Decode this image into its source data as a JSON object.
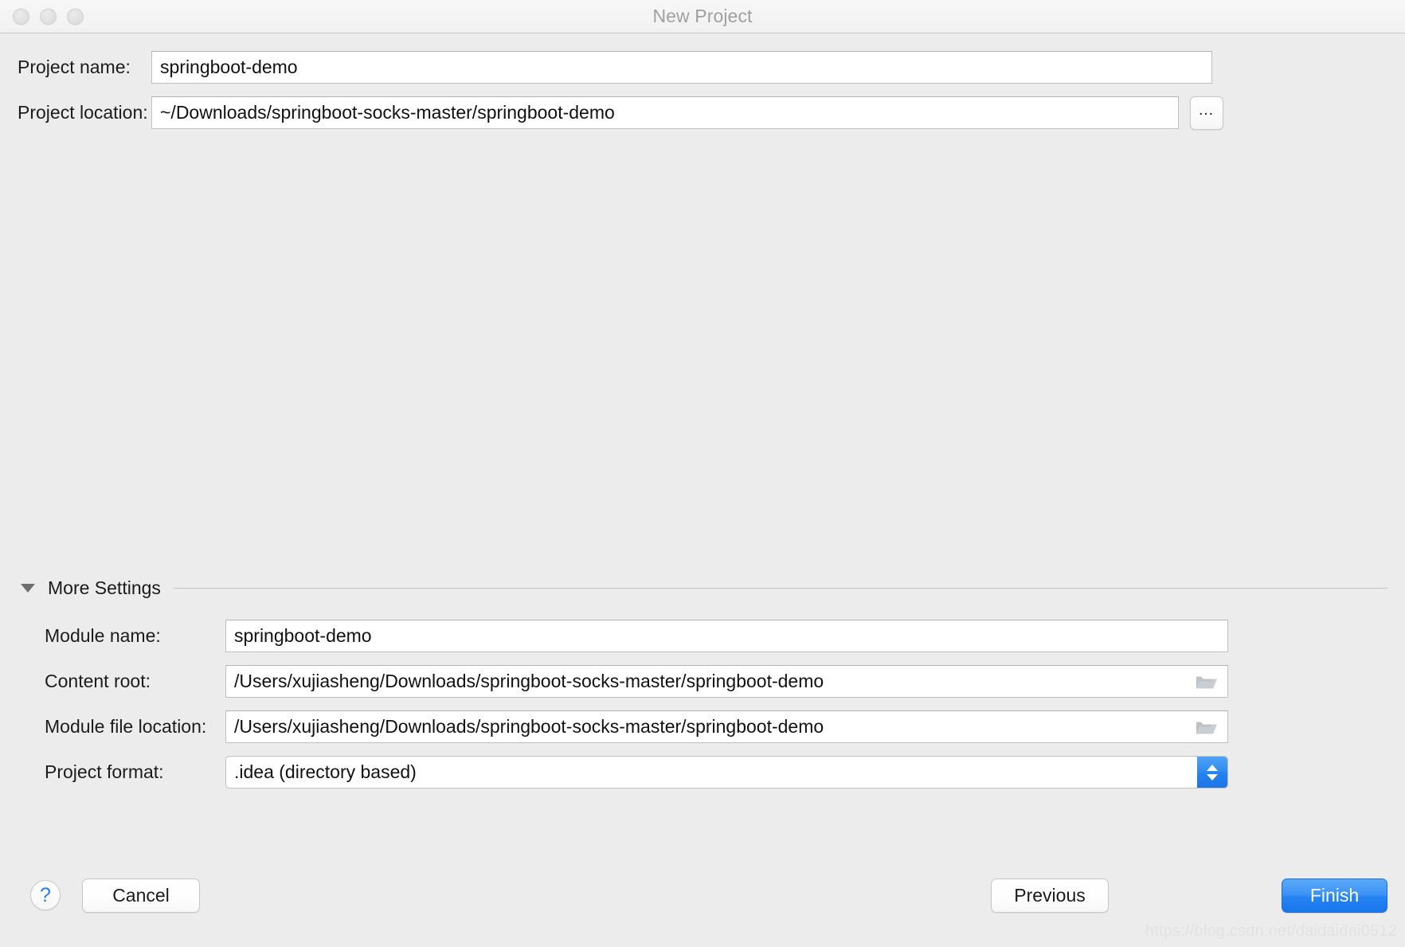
{
  "window": {
    "title": "New Project",
    "traffic_lights": [
      "close",
      "minimize",
      "zoom"
    ]
  },
  "top_form": {
    "project_name": {
      "label": "Project name:",
      "value": "springboot-demo",
      "placeholder": ""
    },
    "project_location": {
      "label": "Project location:",
      "value": "~/Downloads/springboot-socks-master/springboot-demo",
      "placeholder": "",
      "browse_label": "•••"
    }
  },
  "more_settings": {
    "title": "More Settings",
    "expanded": true,
    "disclosure_icon": "triangle-down-icon",
    "fields": {
      "module_name": {
        "label": "Module name:",
        "value": "springboot-demo"
      },
      "content_root": {
        "label": "Content root:",
        "value": "/Users/xujiasheng/Downloads/springboot-socks-master/springboot-demo",
        "icon": "folder-icon"
      },
      "module_file_location": {
        "label": "Module file location:",
        "value": "/Users/xujiasheng/Downloads/springboot-socks-master/springboot-demo",
        "icon": "folder-icon"
      },
      "project_format": {
        "label": "Project format:",
        "value": ".idea (directory based)",
        "options": [
          ".idea (directory based)"
        ],
        "icon": "stepper-updown-icon"
      }
    }
  },
  "footer": {
    "help_label": "?",
    "cancel_label": "Cancel",
    "previous_label": "Previous",
    "finish_label": "Finish"
  },
  "watermark": {
    "text": "https://blog.csdn.net/daidaidai0512"
  },
  "colors": {
    "accent": "#2583f2",
    "window_bg": "#ececec",
    "titlebar_bg": "#f4f4f4",
    "field_bg": "#ffffff",
    "field_border": "#bfbfbf",
    "help_blue": "#2a7df0"
  }
}
